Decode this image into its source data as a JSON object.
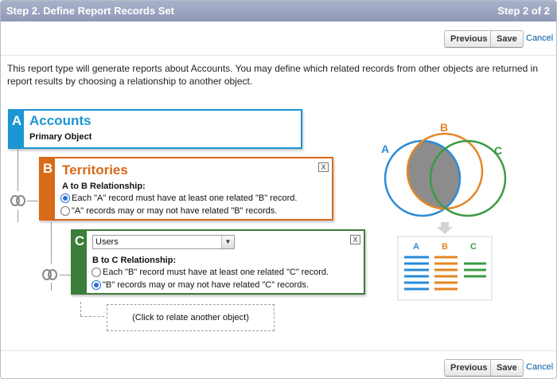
{
  "header": {
    "title": "Step 2. Define Report Records Set",
    "steps": "Step 2 of 2"
  },
  "toolbar": {
    "previous_label": "Previous",
    "save_label": "Save",
    "cancel_label": "Cancel"
  },
  "intro": "This report type will generate reports about Accounts. You may define which related records from other objects are returned in report results by choosing a relationship to another object.",
  "objects": {
    "a": {
      "letter": "A",
      "title": "Accounts",
      "subtitle": "Primary Object",
      "color": "#1b96d3"
    },
    "b": {
      "letter": "B",
      "title": "Territories",
      "relationship_label": "A to B Relationship:",
      "options": [
        "Each \"A\" record must have at least one related \"B\" record.",
        "\"A\" records may or may not have related \"B\" records."
      ],
      "selected_index": 0,
      "close_label": "X",
      "color": "#d96a19"
    },
    "c": {
      "letter": "C",
      "select_value": "Users",
      "relationship_label": "B to C Relationship:",
      "options": [
        "Each \"B\" record must have at least one related \"C\" record.",
        "\"B\" records may or may not have related \"C\" records."
      ],
      "selected_index": 1,
      "close_label": "X",
      "color": "#3c7d3a"
    }
  },
  "relate_label": "(Click to relate another object)",
  "venn": {
    "labels": {
      "a": "A",
      "b": "B",
      "c": "C"
    },
    "colors": {
      "a": "#2a8bd7",
      "b": "#e58624",
      "c": "#3b9a44",
      "overlap": "#8c8c8c"
    }
  },
  "footer": {
    "previous_label": "Previous",
    "save_label": "Save",
    "cancel_label": "Cancel"
  }
}
